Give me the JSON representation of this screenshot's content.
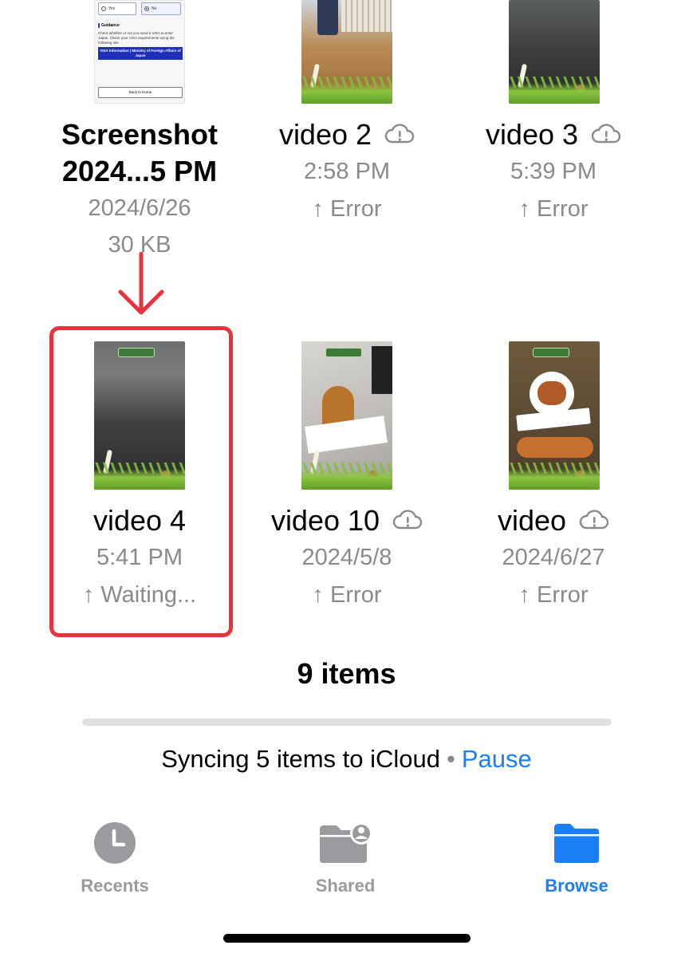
{
  "files": [
    {
      "name": "Screenshot\n2024...5 PM",
      "line1": "Screenshot",
      "line2": "2024...5 PM",
      "date": "2024/6/26",
      "size": "30 KB",
      "cloud_icon": false
    },
    {
      "name": "video 2",
      "date": "2:58 PM",
      "status": "↑ Error",
      "cloud_icon": true
    },
    {
      "name": "video 3",
      "date": "5:39 PM",
      "status": "↑ Error",
      "cloud_icon": true
    },
    {
      "name": "video 4",
      "date": "5:41 PM",
      "status": "↑ Waiting...",
      "cloud_icon": false
    },
    {
      "name": "video 10",
      "date": "2024/5/8",
      "status": "↑ Error",
      "cloud_icon": true
    },
    {
      "name": "video",
      "date": "2024/6/27",
      "status": "↑ Error",
      "cloud_icon": true
    }
  ],
  "screenshot_thumb": {
    "yes": "Yes",
    "no": "No",
    "guidance": "Guidance",
    "guidance_text": "Check whether or not you need a VISA to enter Japan. Check your VISA requirements using the following site",
    "visa_link": "VISA Information | Ministry of Foreign Affairs of Japan",
    "back": "Back to Home"
  },
  "summary": {
    "items_count": "9 items",
    "sync_text": "Syncing 5 items to iCloud",
    "separator": "•",
    "pause": "Pause",
    "progress": 0.0
  },
  "tabs": [
    {
      "label": "Recents",
      "icon": "clock-icon",
      "active": false
    },
    {
      "label": "Shared",
      "icon": "shared-folder-icon",
      "active": false
    },
    {
      "label": "Browse",
      "icon": "folder-icon",
      "active": true
    }
  ],
  "colors": {
    "accent": "#1a7ef5",
    "highlight": "#e8323c",
    "secondary_text": "#8a8a8e"
  }
}
